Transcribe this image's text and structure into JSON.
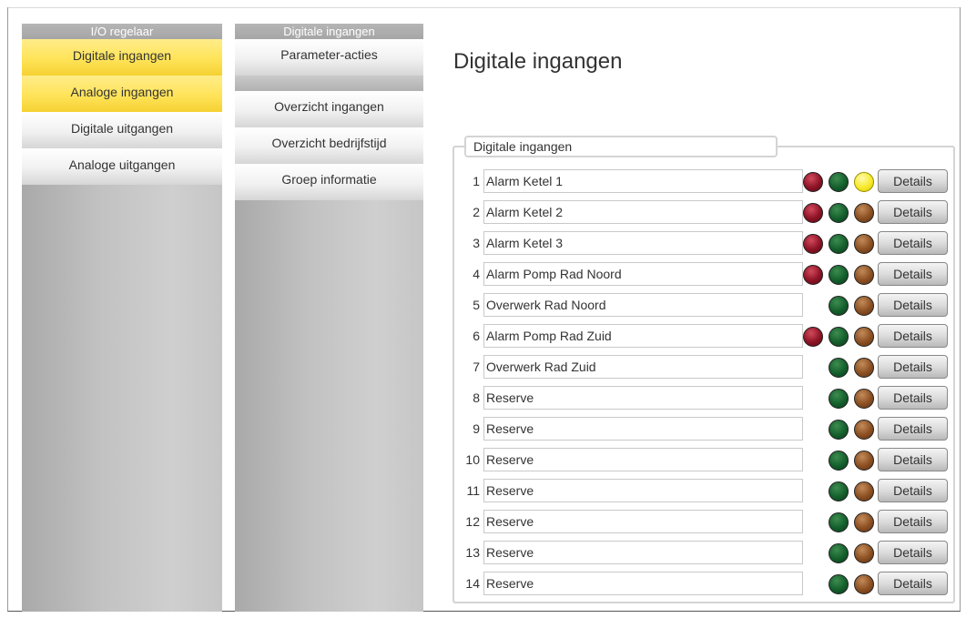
{
  "nav1": {
    "header": "I/O regelaar",
    "items": [
      {
        "label": "Digitale ingangen",
        "active": true
      },
      {
        "label": "Analoge ingangen",
        "active": true
      },
      {
        "label": "Digitale uitgangen",
        "active": false
      },
      {
        "label": "Analoge uitgangen",
        "active": false
      }
    ]
  },
  "nav2": {
    "header": "Digitale ingangen",
    "top_item": "Parameter-acties",
    "items": [
      {
        "label": "Overzicht ingangen"
      },
      {
        "label": "Overzicht bedrijfstijd"
      },
      {
        "label": "Groep informatie"
      }
    ]
  },
  "main": {
    "title": "Digitale ingangen",
    "group_title": "Digitale ingangen",
    "details_label": "Details",
    "rows": [
      {
        "num": "1",
        "name": "Alarm Ketel 1",
        "leds": [
          "red",
          "green",
          "yellow"
        ]
      },
      {
        "num": "2",
        "name": "Alarm Ketel 2",
        "leds": [
          "red",
          "green",
          "brown"
        ]
      },
      {
        "num": "3",
        "name": "Alarm Ketel 3",
        "leds": [
          "red",
          "green",
          "brown"
        ]
      },
      {
        "num": "4",
        "name": "Alarm Pomp Rad Noord",
        "leds": [
          "red",
          "green",
          "brown"
        ]
      },
      {
        "num": "5",
        "name": "Overwerk Rad Noord",
        "leds": [
          "green",
          "brown"
        ]
      },
      {
        "num": "6",
        "name": "Alarm Pomp Rad Zuid",
        "leds": [
          "red",
          "green",
          "brown"
        ]
      },
      {
        "num": "7",
        "name": "Overwerk Rad Zuid",
        "leds": [
          "green",
          "brown"
        ]
      },
      {
        "num": "8",
        "name": "Reserve",
        "leds": [
          "green",
          "brown"
        ]
      },
      {
        "num": "9",
        "name": "Reserve",
        "leds": [
          "green",
          "brown"
        ]
      },
      {
        "num": "10",
        "name": "Reserve",
        "leds": [
          "green",
          "brown"
        ]
      },
      {
        "num": "11",
        "name": "Reserve",
        "leds": [
          "green",
          "brown"
        ]
      },
      {
        "num": "12",
        "name": "Reserve",
        "leds": [
          "green",
          "brown"
        ]
      },
      {
        "num": "13",
        "name": "Reserve",
        "leds": [
          "green",
          "brown"
        ]
      },
      {
        "num": "14",
        "name": "Reserve",
        "leds": [
          "green",
          "brown"
        ]
      }
    ]
  },
  "colors": {
    "active_nav": "#ffe459",
    "led_red": "#8c1325",
    "led_green": "#145f2c",
    "led_brown": "#8b4f22",
    "led_yellow": "#f7ea2c"
  }
}
